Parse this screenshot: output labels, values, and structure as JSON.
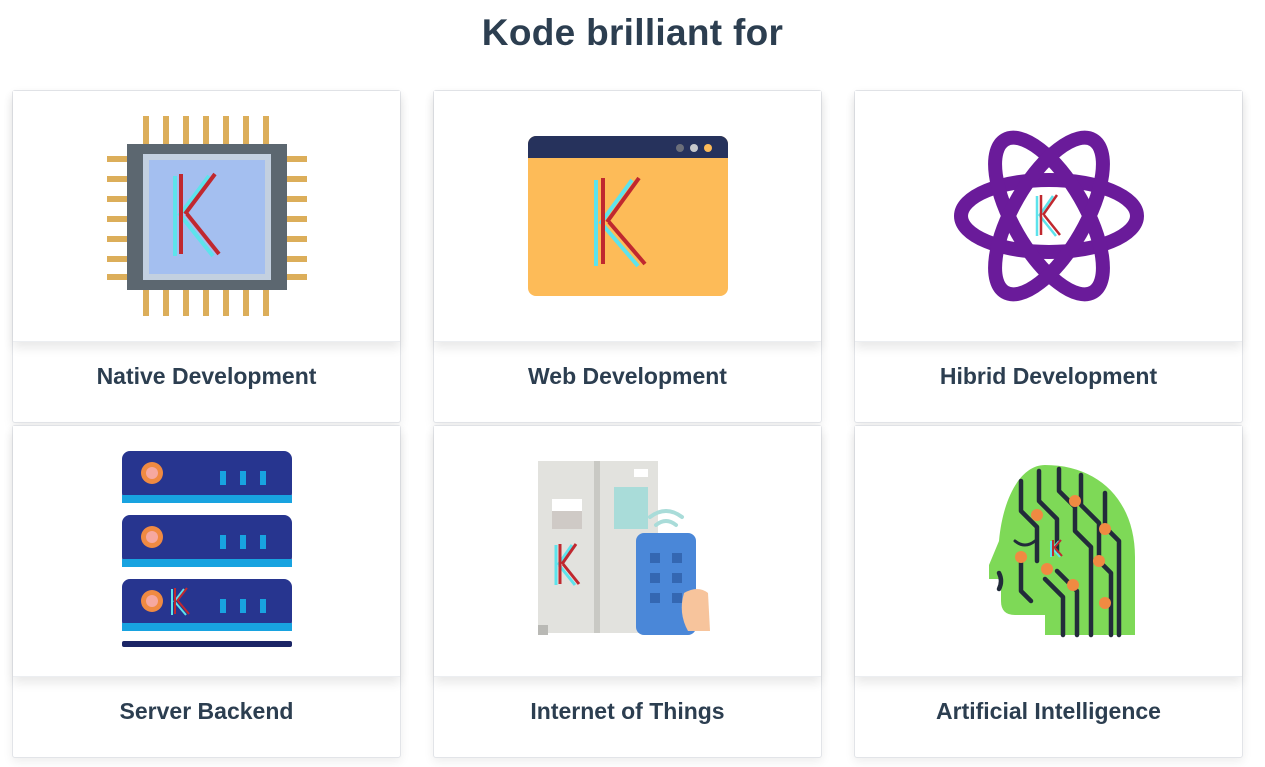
{
  "page": {
    "title": "Kode brilliant for"
  },
  "cards": [
    {
      "label": "Native Development",
      "icon": "cpu-chip-icon"
    },
    {
      "label": "Web Development",
      "icon": "browser-window-icon"
    },
    {
      "label": "Hibrid Development",
      "icon": "atom-star-icon"
    },
    {
      "label": "Server Backend",
      "icon": "server-stack-icon"
    },
    {
      "label": "Internet of Things",
      "icon": "smart-fridge-phone-icon"
    },
    {
      "label": "Artificial Intelligence",
      "icon": "ai-circuit-head-icon"
    }
  ],
  "colors": {
    "text": "#2c3e50",
    "chip_pins": "#dcae5a",
    "chip_body": "#5c6770",
    "chip_core": "#a4bff0",
    "browser_bar": "#26325c",
    "browser_body": "#fdbb58",
    "atom": "#6a1b9a",
    "server": "#27358f",
    "server_accent": "#18a3e0",
    "ai_head": "#7ed957",
    "ai_dot": "#f08a42",
    "k_cyan": "#5de3ec",
    "k_red": "#c0282f"
  }
}
